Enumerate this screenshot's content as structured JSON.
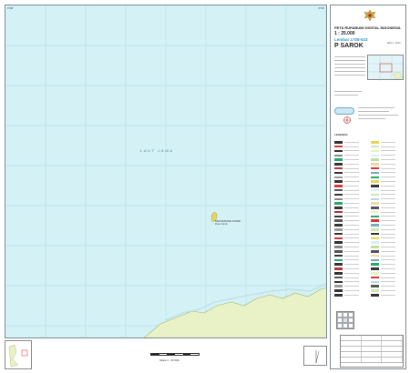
{
  "map": {
    "sea_label": "LAUT JAWA",
    "island_label": "KECAMATAN PASIR",
    "island_sublabel": "Pulau Sarok",
    "corner_top_left": "0°00'",
    "corner_top_right": "0°00'",
    "tick_left_1": "",
    "tick_left_2": ""
  },
  "sidebar": {
    "title_line1": "PETA RUPABUMI DIGITAL INDONESIA",
    "scale": "1 : 25.000",
    "sheet_number": "Lembar 1708-533",
    "sheet_name": "P SAROK",
    "edition": "Edisi I - 2010",
    "legend_title": "LEGENDA"
  },
  "bottom": {
    "scale_text": "Skala 1 : 25.000"
  },
  "colors": {
    "sea": "#d4f1f6",
    "land": "#e9f2c6",
    "land_stroke": "#9fb56b",
    "grid": "#a7dbe8",
    "title_blue": "#3399cc"
  }
}
